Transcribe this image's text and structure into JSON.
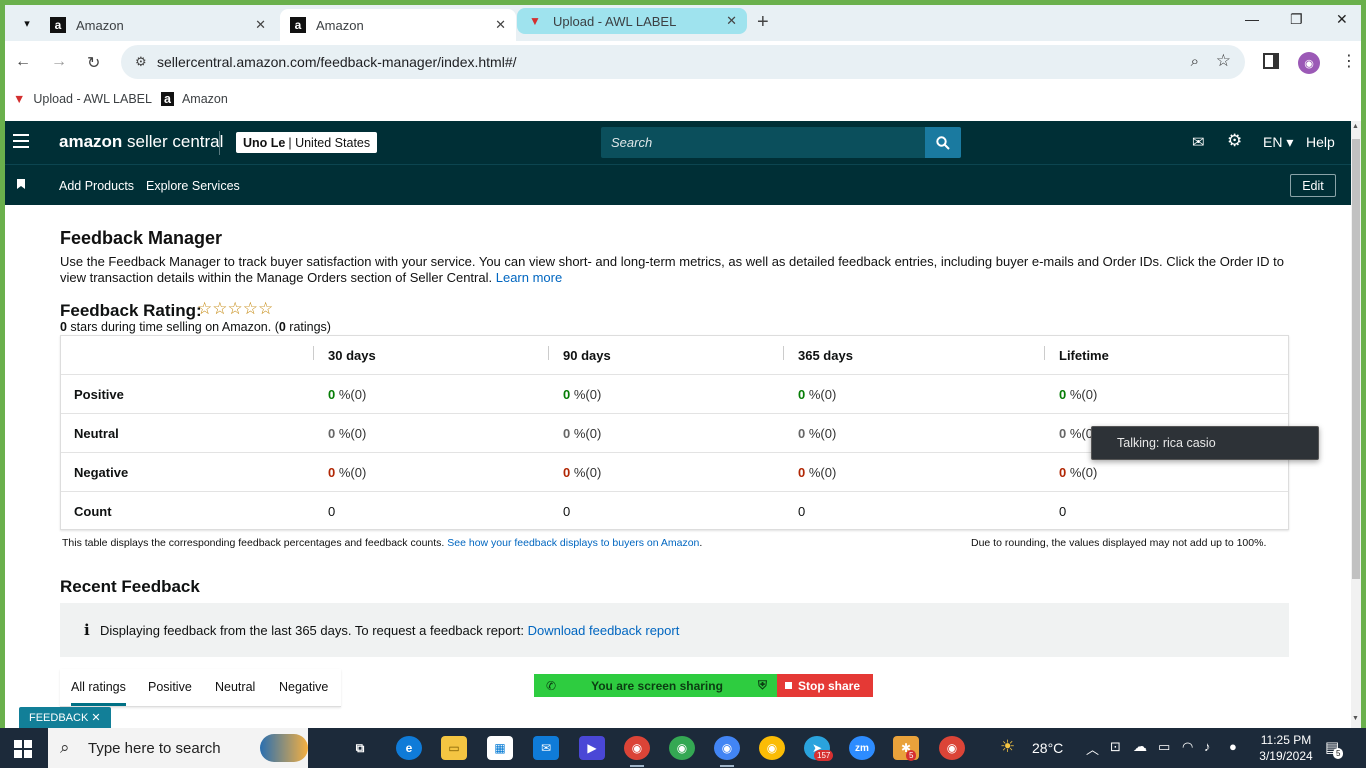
{
  "browser": {
    "tabs": [
      {
        "title": "Amazon",
        "favicon": "amazon-icon"
      },
      {
        "title": "Amazon",
        "favicon": "amazon-icon"
      },
      {
        "title": "Upload - AWL LABEL",
        "favicon": "awl-icon"
      }
    ],
    "url": "sellercentral.amazon.com/feedback-manager/index.html#/",
    "bookmarks": [
      {
        "label": "Upload - AWL LABEL"
      },
      {
        "label": "Amazon"
      }
    ]
  },
  "header": {
    "logo_bold": "amazon",
    "logo_rest": " seller central",
    "account_name": "Uno Le",
    "account_region": "| United States",
    "search_placeholder": "Search",
    "language": "EN",
    "help": "Help"
  },
  "subnav": {
    "links": [
      "Add Products",
      "Explore Services"
    ],
    "edit": "Edit"
  },
  "feedback_manager": {
    "title": "Feedback Manager",
    "description": "Use the Feedback Manager to track buyer satisfaction with your service. You can view short- and long-term metrics, as well as detailed feedback entries, including buyer e-mails and Order IDs. Click the Order ID to view transaction details within the Manage Orders section of Seller Central.",
    "learn_more": "Learn more",
    "rating_title": "Feedback Rating:",
    "stars": "☆☆☆☆☆",
    "stars_value": "0",
    "stars_text": " stars during time selling on Amazon. (",
    "ratings_count": "0",
    "ratings_text": " ratings)"
  },
  "table": {
    "columns": [
      "30 days",
      "90 days",
      "365 days",
      "Lifetime"
    ],
    "rows": [
      {
        "label": "Positive",
        "cells": [
          [
            "0",
            " %(0)"
          ],
          [
            "0",
            " %(0)"
          ],
          [
            "0",
            " %(0)"
          ],
          [
            "0",
            " %(0)"
          ]
        ]
      },
      {
        "label": "Neutral",
        "cells": [
          [
            "0",
            " %(0)"
          ],
          [
            "0",
            " %(0)"
          ],
          [
            "0",
            " %(0)"
          ],
          [
            "0",
            " %(0"
          ]
        ]
      },
      {
        "label": "Negative",
        "cells": [
          [
            "0",
            " %(0)"
          ],
          [
            "0",
            " %(0)"
          ],
          [
            "0",
            " %(0)"
          ],
          [
            "0",
            " %(0)"
          ]
        ]
      },
      {
        "label": "Count",
        "cells": [
          "0",
          "0",
          "0",
          "0"
        ]
      }
    ],
    "note": "This table displays the corresponding feedback percentages and feedback counts.",
    "note_link": "See how your feedback displays to buyers on Amazon",
    "note_right": "Due to rounding, the values displayed may not add up to 100%."
  },
  "recent": {
    "title": "Recent Feedback",
    "info": "Displaying feedback from the last 365 days. To request a feedback report:",
    "info_link": "Download feedback report",
    "tabs": [
      "All ratings",
      "Positive",
      "Neutral",
      "Negative"
    ]
  },
  "overlays": {
    "feedback_chip": "FEEDBACK",
    "sharing": "You are screen sharing",
    "stop_share": "Stop share",
    "talking": "Talking: rica casio"
  },
  "taskbar": {
    "search_placeholder": "Type here to search",
    "weather": "28°C",
    "time": "11:25 PM",
    "date": "3/19/2024",
    "badges": {
      "telegram": "157",
      "slack": "5",
      "notifications": "5"
    }
  }
}
